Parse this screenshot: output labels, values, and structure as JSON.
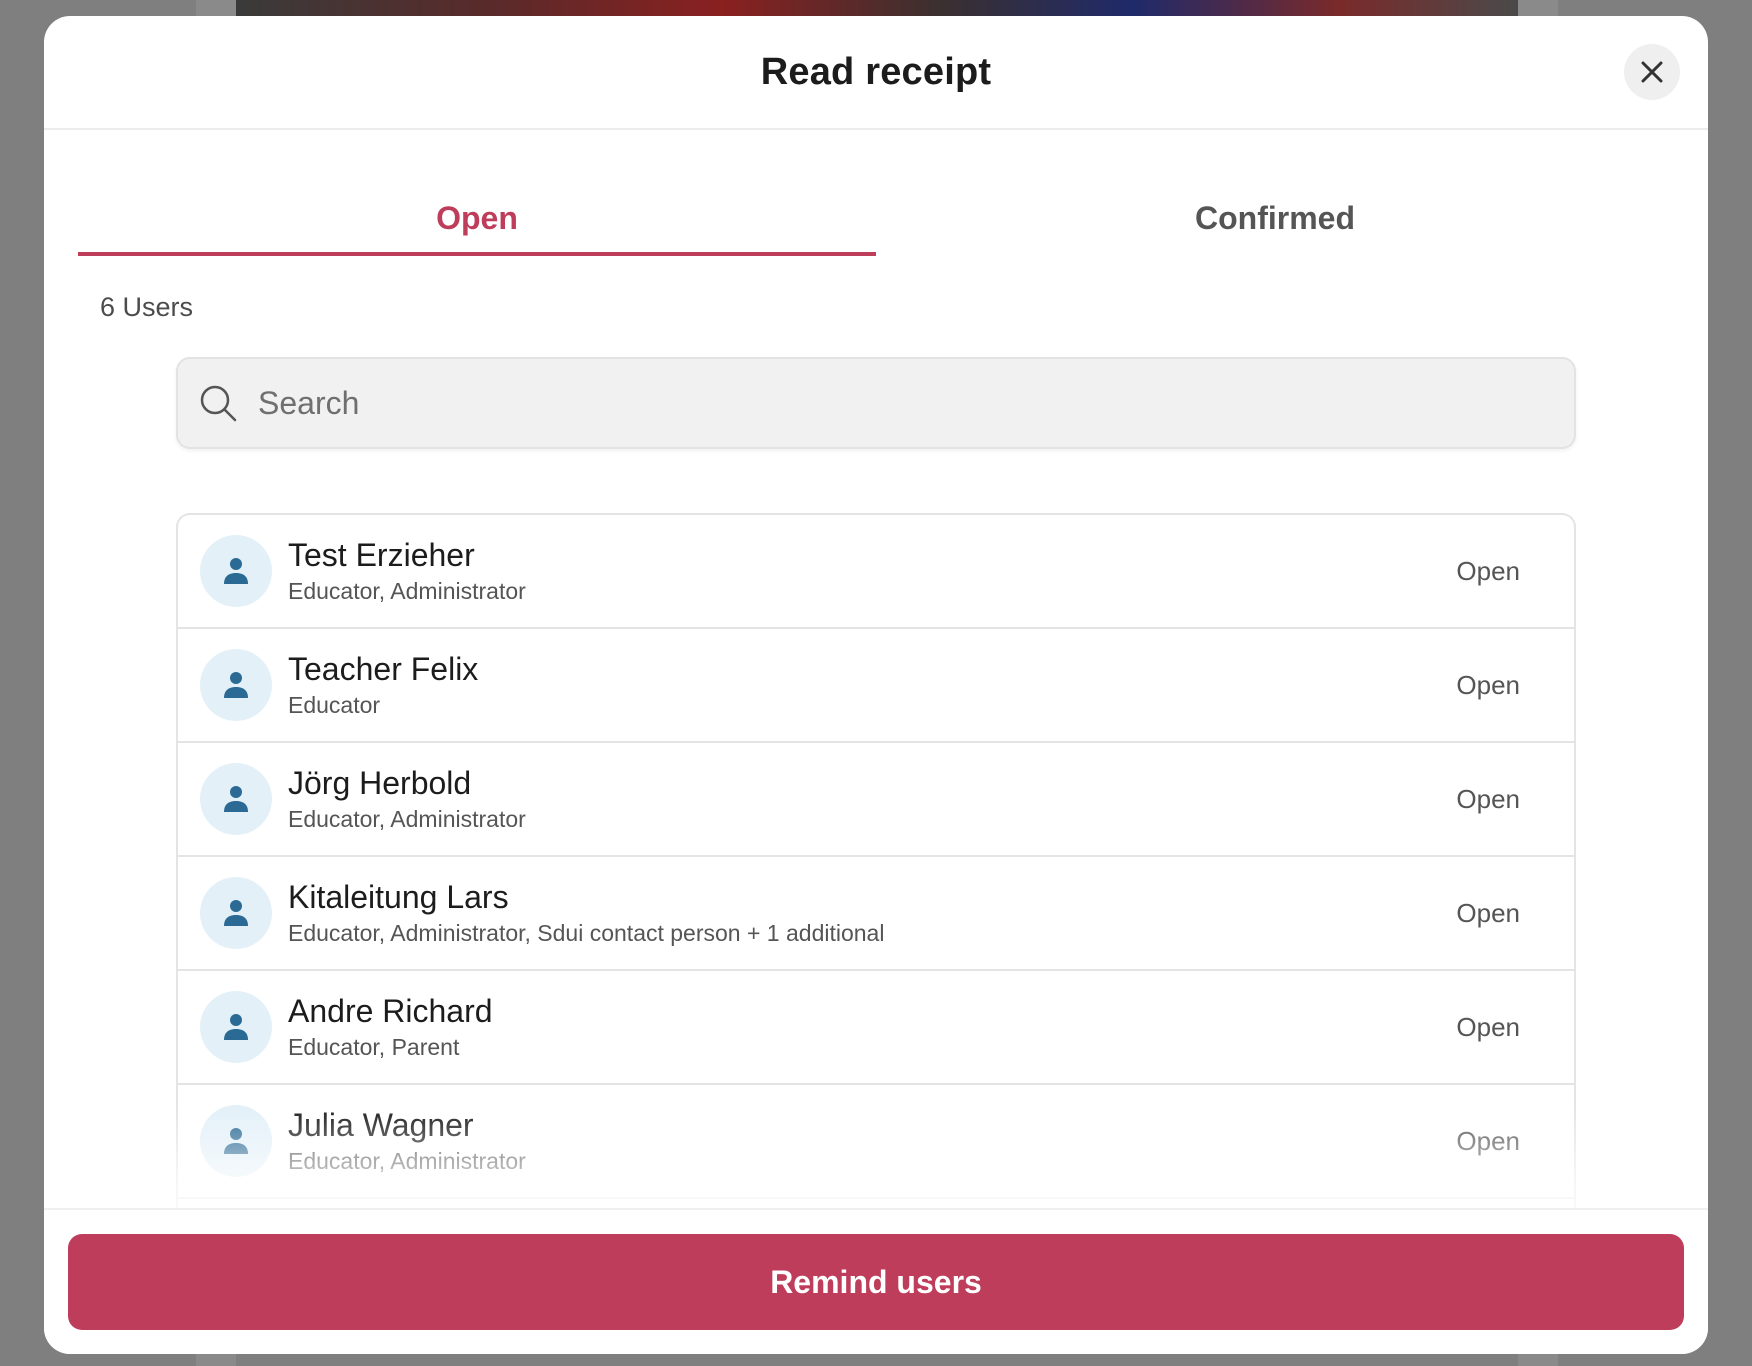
{
  "modal": {
    "title": "Read receipt",
    "close_icon": "close-icon"
  },
  "tabs": [
    {
      "label": "Open",
      "active": true
    },
    {
      "label": "Confirmed",
      "active": false
    }
  ],
  "user_count": "6 Users",
  "search": {
    "placeholder": "Search",
    "value": "",
    "icon": "search-icon"
  },
  "users": [
    {
      "name": "Test Erzieher",
      "roles": "Educator, Administrator",
      "status": "Open"
    },
    {
      "name": "Teacher Felix",
      "roles": "Educator",
      "status": "Open"
    },
    {
      "name": "Jörg Herbold",
      "roles": "Educator, Administrator",
      "status": "Open"
    },
    {
      "name": "Kitaleitung Lars",
      "roles": "Educator, Administrator, Sdui contact person + 1 additional",
      "status": "Open"
    },
    {
      "name": "Andre Richard",
      "roles": "Educator, Parent",
      "status": "Open"
    },
    {
      "name": "Julia Wagner",
      "roles": "Educator, Administrator",
      "status": "Open"
    }
  ],
  "footer": {
    "remind_label": "Remind users"
  },
  "colors": {
    "accent": "#be3d5b",
    "avatar_bg": "#e3f0f8",
    "avatar_icon": "#2b6a95",
    "backdrop": "#7f7f7f"
  }
}
